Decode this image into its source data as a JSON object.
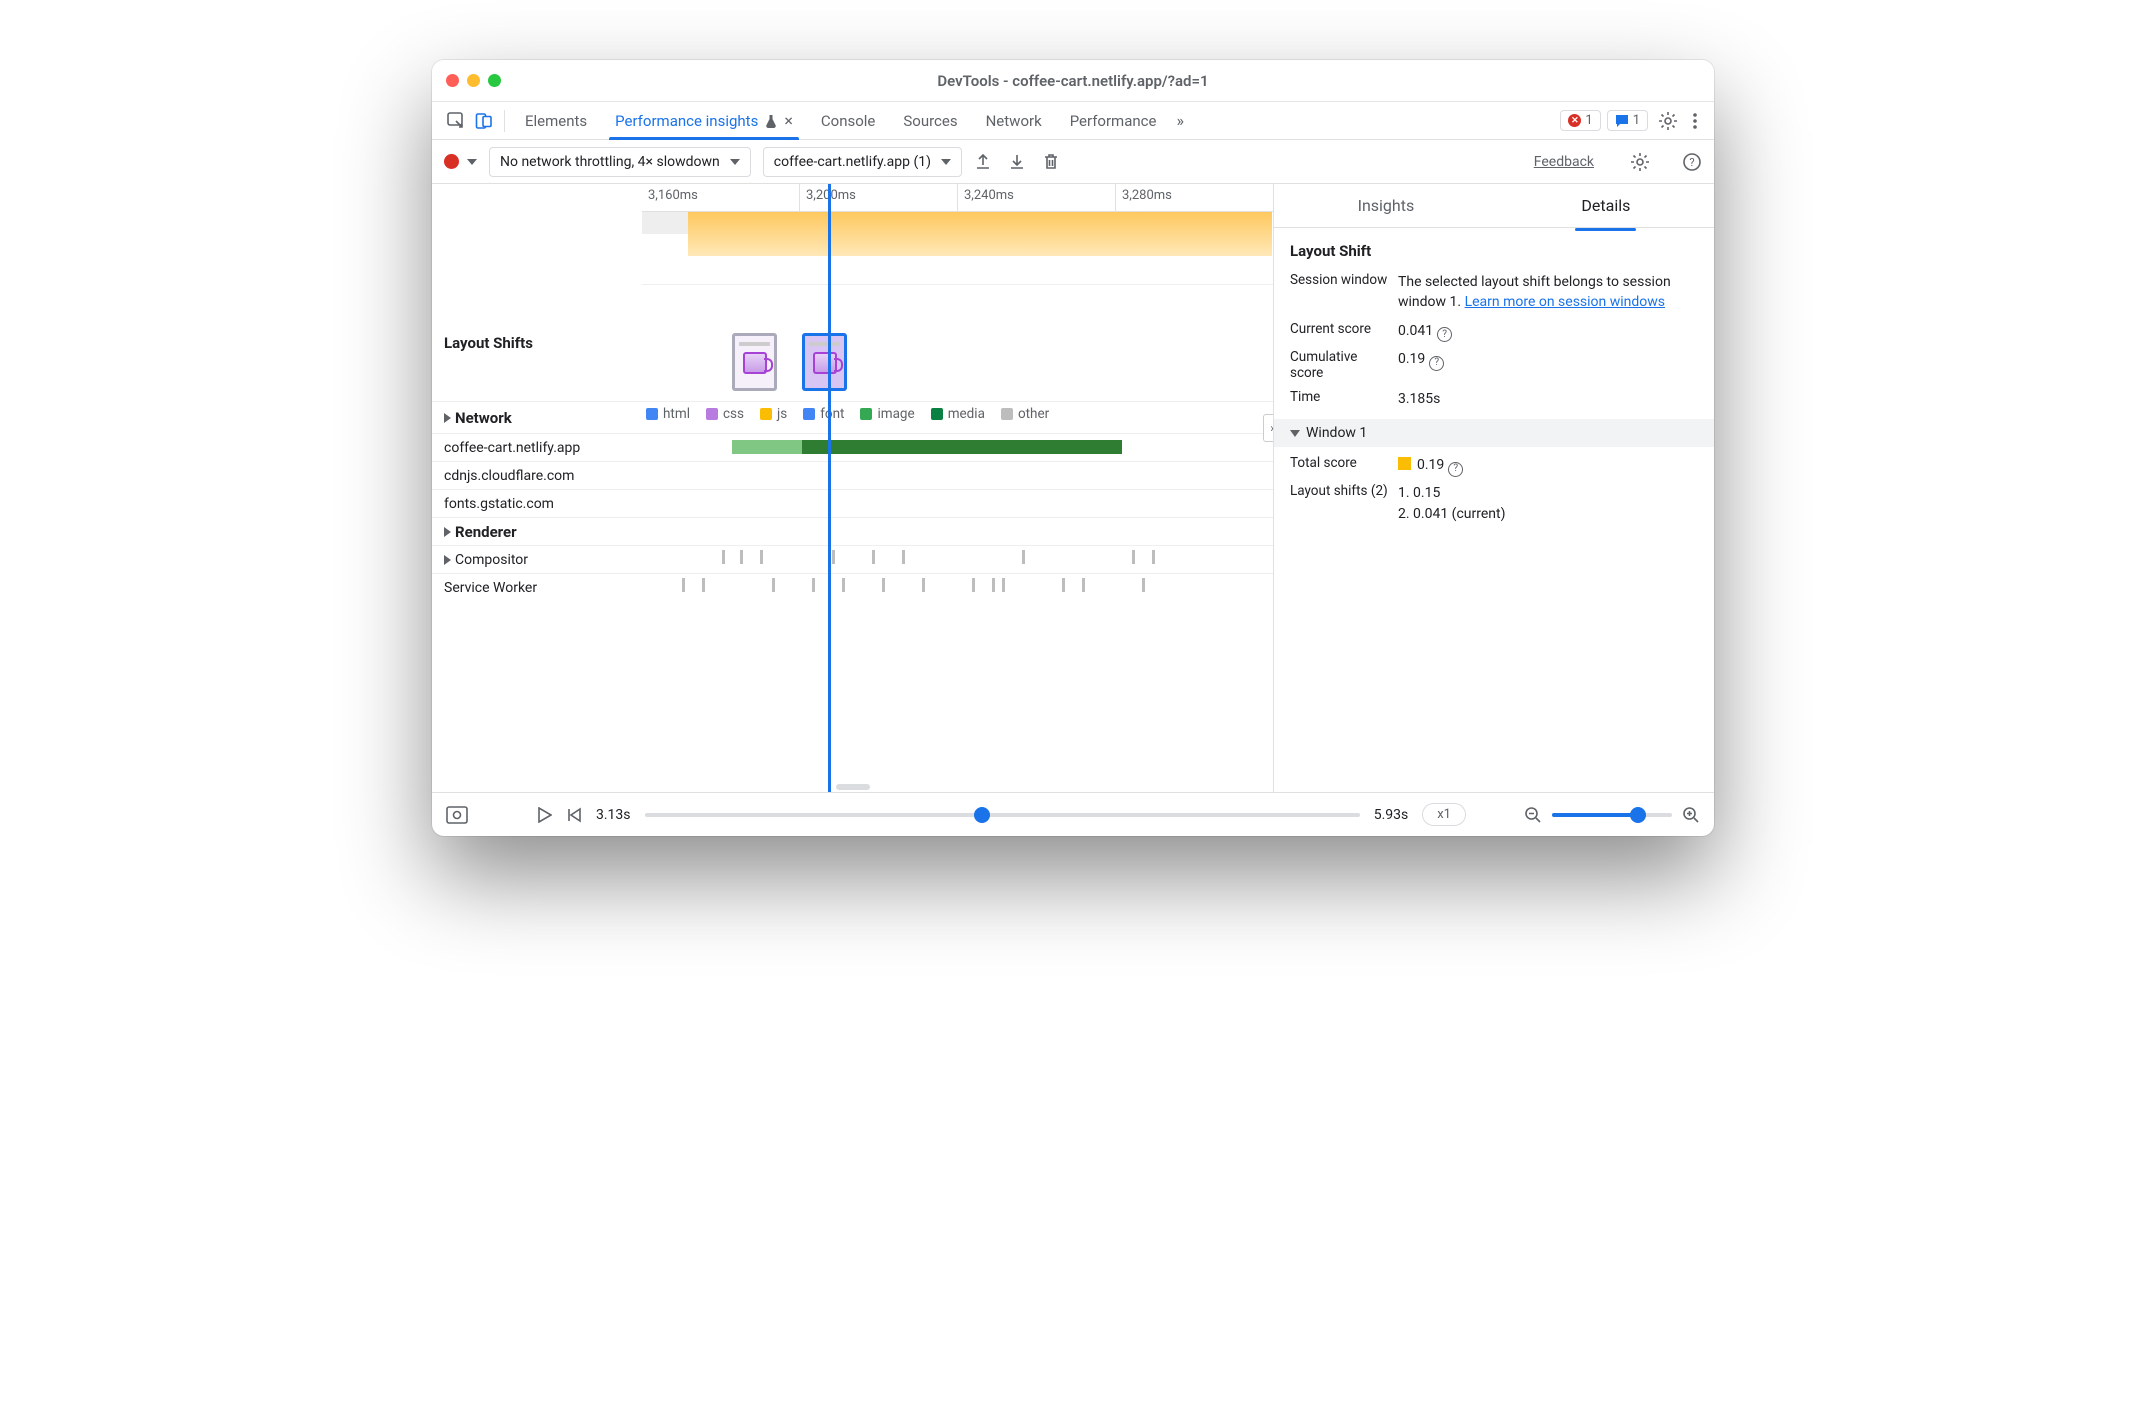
{
  "window_title": "DevTools - coffee-cart.netlify.app/?ad=1",
  "tabs": {
    "elements": "Elements",
    "perf_insights": "Performance insights",
    "console": "Console",
    "sources": "Sources",
    "network": "Network",
    "performance": "Performance"
  },
  "error_count": "1",
  "msg_count": "1",
  "toolbar": {
    "throttle": "No network throttling, 4× slowdown",
    "session": "coffee-cart.netlify.app (1)",
    "feedback": "Feedback"
  },
  "ruler": {
    "t0": "3,160ms",
    "t1": "3,200ms",
    "t2": "3,240ms",
    "t3": "3,280ms"
  },
  "rows": {
    "layout_shifts": "Layout Shifts",
    "network": "Network",
    "renderer": "Renderer",
    "compositor": "Compositor",
    "service_worker": "Service Worker"
  },
  "legend": {
    "html": "html",
    "css": "css",
    "js": "js",
    "font": "font",
    "image": "image",
    "media": "media",
    "other": "other"
  },
  "hosts": {
    "h0": "coffee-cart.netlify.app",
    "h1": "cdnjs.cloudflare.com",
    "h2": "fonts.gstatic.com"
  },
  "right": {
    "tab_insights": "Insights",
    "tab_details": "Details",
    "title": "Layout Shift",
    "session_label": "Session window",
    "session_text": "The selected layout shift belongs to session window 1. ",
    "session_link": "Learn more on session windows",
    "current_label": "Current score",
    "current_value": "0.041",
    "cum_label": "Cumulative score",
    "cum_value": "0.19",
    "time_label": "Time",
    "time_value": "3.185s",
    "win_header": "Window 1",
    "total_label": "Total score",
    "total_value": "0.19",
    "shifts_label": "Layout shifts (2)",
    "shift1": "1. 0.15",
    "shift2": "2. 0.041 (current)"
  },
  "footer": {
    "start": "3.13s",
    "end": "5.93s",
    "speed": "x1"
  }
}
